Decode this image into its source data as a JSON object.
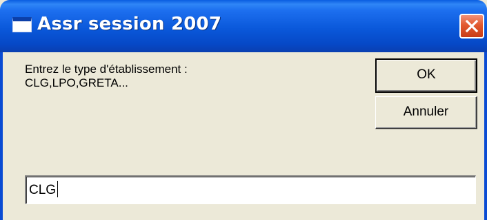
{
  "window": {
    "title": "Assr session 2007",
    "icon": "window-app-icon",
    "close_icon": "close-x-icon",
    "title_color": "#FFFFFF",
    "titlebar_color": "#0A58DA",
    "close_color": "#E2592F"
  },
  "prompt": {
    "line1": "Entrez le type d'établissement :",
    "line2": "CLG,LPO,GRETA..."
  },
  "buttons": {
    "ok_label": "OK",
    "cancel_label": "Annuler"
  },
  "input": {
    "value": "CLG"
  }
}
